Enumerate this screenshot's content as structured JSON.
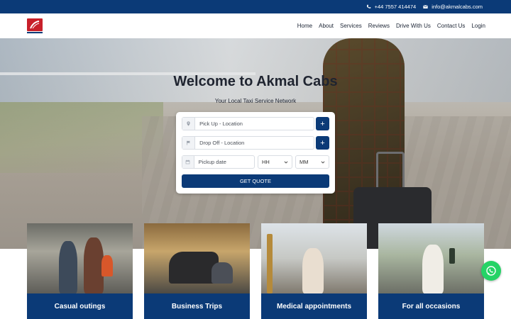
{
  "topbar": {
    "phone": "+44 7557 414474",
    "email": "info@akmalcabs.com"
  },
  "nav": {
    "items": [
      "Home",
      "About",
      "Services",
      "Reviews",
      "Drive With Us",
      "Contact Us",
      "Login"
    ]
  },
  "hero": {
    "title": "Welcome to Akmal Cabs",
    "subtitle": "Your Local Taxi Service Network"
  },
  "form": {
    "pickup_placeholder": "Pick Up - Location",
    "dropoff_placeholder": "Drop Off - Location",
    "date_placeholder": "Pickup date",
    "hour_value": "HH",
    "minute_value": "MM",
    "submit_label": "GET QUOTE"
  },
  "cards": [
    {
      "caption": "Casual outings"
    },
    {
      "caption": "Business Trips"
    },
    {
      "caption": "Medical appointments"
    },
    {
      "caption": "For all occasions"
    }
  ],
  "colors": {
    "primary": "#0b3a77",
    "whatsapp": "#25d366",
    "logo_red": "#c8202a"
  },
  "icons": {
    "phone": "phone-icon",
    "email": "envelope-icon",
    "pickup": "location-pin-icon",
    "dropoff": "flag-icon",
    "date": "calendar-icon",
    "add": "plus-icon",
    "dropdown": "chevron-down-icon",
    "chat": "whatsapp-icon"
  }
}
